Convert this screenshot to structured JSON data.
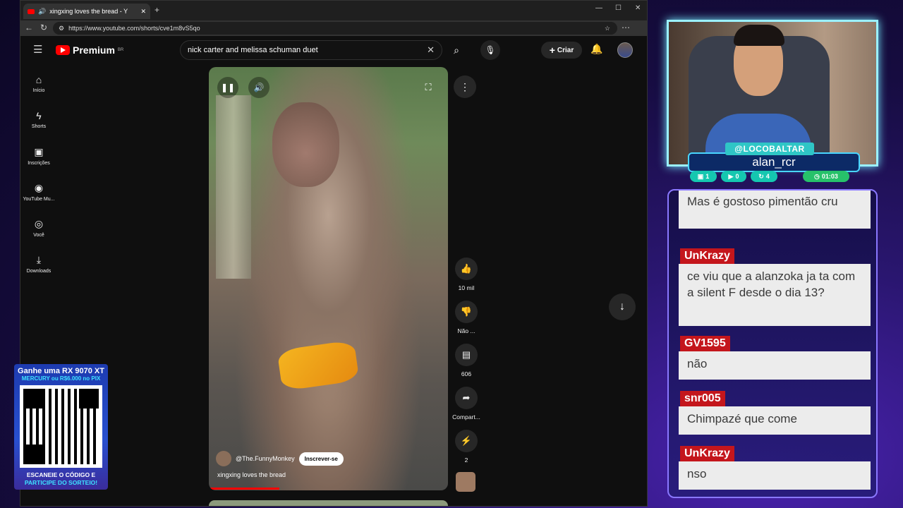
{
  "browser": {
    "tab_title": "xingxing loves the bread - Y",
    "url": "https://www.youtube.com/shorts/cve1m8vS5qo"
  },
  "youtube": {
    "logo": "Premium",
    "logo_region": "BR",
    "search_query": "nick carter and melissa schuman duet",
    "create_label": "Criar",
    "sidebar": [
      {
        "label": "Início",
        "icon": "home-icon"
      },
      {
        "label": "Shorts",
        "icon": "shorts-icon"
      },
      {
        "label": "Inscrições",
        "icon": "subscriptions-icon"
      },
      {
        "label": "YouTube Mu...",
        "icon": "youtube-music-icon"
      },
      {
        "label": "Você",
        "icon": "you-icon"
      },
      {
        "label": "Downloads",
        "icon": "download-icon"
      }
    ],
    "short": {
      "channel": "@The.FunnyMonkey",
      "subscribe_label": "Inscrever-se",
      "title": "xingxing loves the bread"
    },
    "actions": {
      "likes": "10 mil",
      "dislike": "Não ...",
      "comments": "606",
      "share": "Compart...",
      "remix": "2"
    }
  },
  "overlay": {
    "handle": "@LOCOBALTAR",
    "viewer": "alan_rcr",
    "stats": {
      "messages": "1",
      "videos": "0",
      "extra": "4",
      "timer": "01:03"
    }
  },
  "chat": [
    {
      "user": "",
      "message": "Mas é gostoso pimentão cru"
    },
    {
      "user": "UnKrazy",
      "message": "ce viu que a alanzoka ja ta com a silent F desde o dia 13?"
    },
    {
      "user": "GV1595",
      "message": "não"
    },
    {
      "user": "snr005",
      "message": "Chimpazé que come"
    },
    {
      "user": "UnKrazy",
      "message": "nso"
    }
  ],
  "promo": {
    "line1": "Ganhe uma RX 9070 XT",
    "line2": "MERCURY ou R$6.000 no PIX",
    "line3": "ESCANEIE O CÓDIGO E",
    "line4": "PARTICIPE DO SORTEIO!"
  }
}
